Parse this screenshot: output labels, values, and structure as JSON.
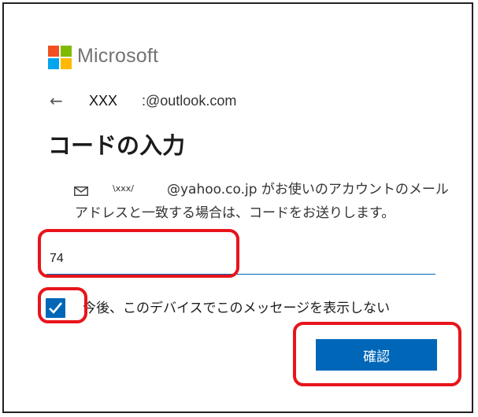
{
  "brand": {
    "name": "Microsoft",
    "logo_colors": [
      "#f25022",
      "#7fba00",
      "#00a4ef",
      "#ffb900"
    ]
  },
  "account": {
    "back_icon": "left-arrow-icon",
    "email_prefix": "XXX",
    "email_domain": ":@outlook.com"
  },
  "page": {
    "title": "コードの入力"
  },
  "description": {
    "icon": "mail-icon",
    "masked_name": "\\xxx/",
    "line1": "@yahoo.co.jp がお使いのアカウントのメール",
    "line2": "アドレスと一致する場合は、コードをお送りします。"
  },
  "code_field": {
    "value": "74"
  },
  "remember": {
    "checked": true,
    "label": "今後、このデバイスでこのメッセージを表示しない"
  },
  "actions": {
    "confirm_label": "確認"
  },
  "colors": {
    "accent": "#0067b8",
    "annotation": "#e8141b"
  }
}
